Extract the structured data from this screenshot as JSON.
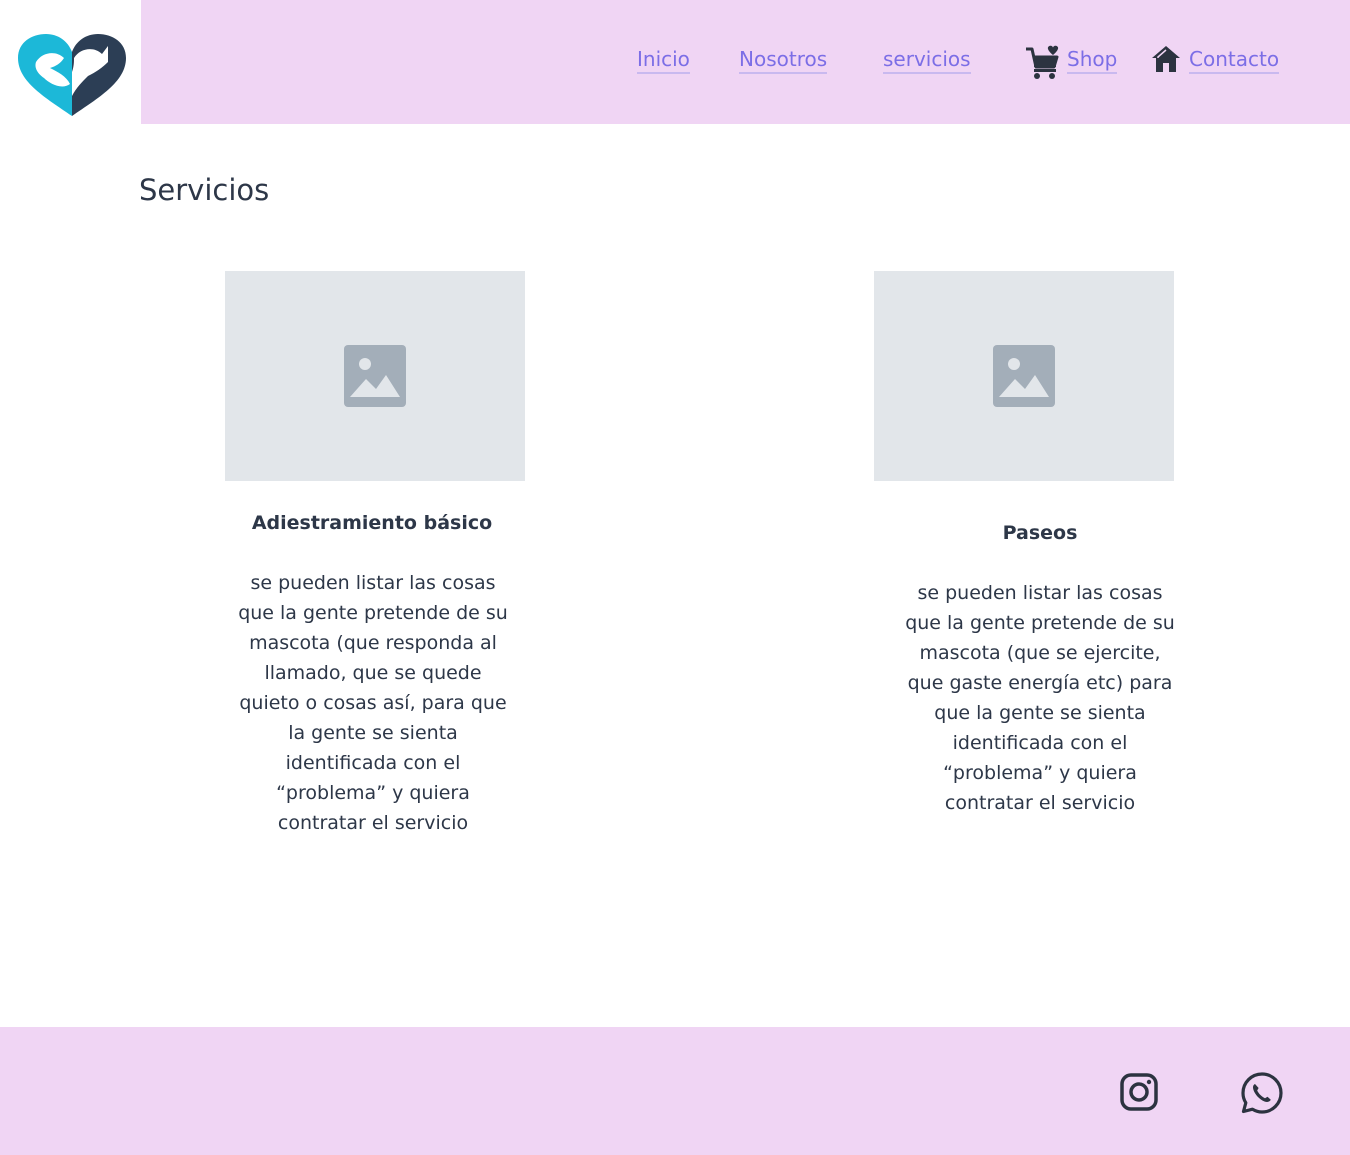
{
  "header": {
    "logo_icon": "heart-pets-logo-icon",
    "nav": {
      "inicio": "Inicio",
      "nosotros": "Nosotros",
      "servicios": "servicios",
      "shop": "Shop",
      "contacto": "Contacto"
    },
    "colors": {
      "background": "#f0d5f4",
      "link": "#7c6ee6",
      "logo_teal": "#1cb8d8",
      "logo_navy": "#2c3e55"
    }
  },
  "main": {
    "title": "Servicios",
    "cards": [
      {
        "title": "Adiestramiento básico",
        "description": "se pueden listar las cosas que la gente pretende de su mascota (que responda al llamado, que se quede quieto o cosas así, para que la gente se sienta identificada con el “problema” y quiera contratar el servicio",
        "image_icon": "image-placeholder-icon"
      },
      {
        "title": "Paseos",
        "description": "se pueden listar las cosas que la gente pretende de su mascota (que se ejercite, que gaste energía etc) para que la gente se sienta identificada con el “problema” y quiera contratar el servicio",
        "image_icon": "image-placeholder-icon"
      }
    ]
  },
  "footer": {
    "social_icons": [
      "instagram-icon",
      "whatsapp-icon"
    ],
    "background": "#f0d5f4"
  }
}
